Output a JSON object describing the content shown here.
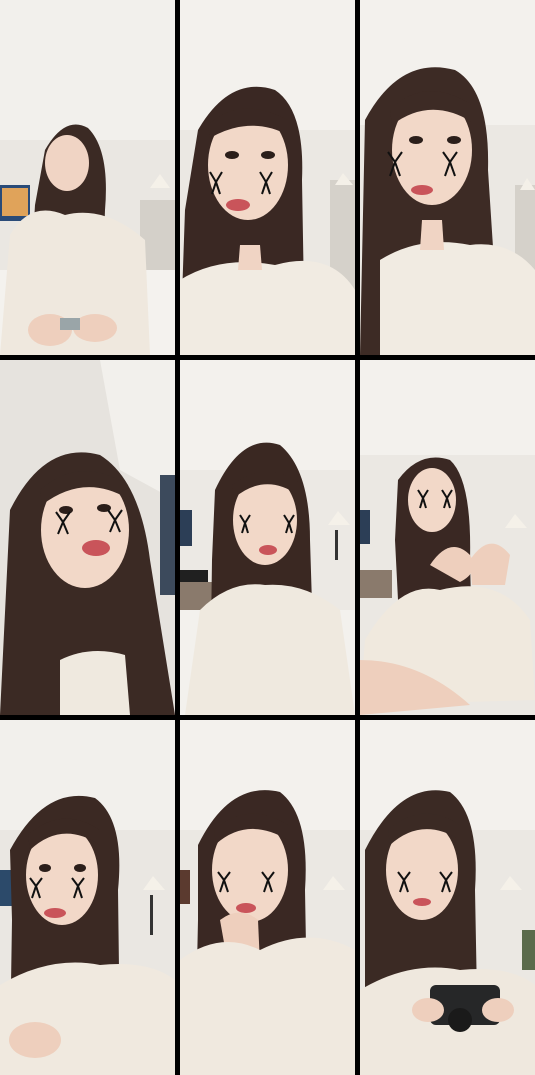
{
  "grid": {
    "rows": 3,
    "cols": 3,
    "background": "#000000",
    "tiles": [
      {
        "scene": "wide-seated-room",
        "wall": "#eae7e2",
        "sweater": "#efe8de",
        "hair": "#3b2a24"
      },
      {
        "scene": "closeup-left",
        "wall": "#ebe8e3",
        "sweater": "#f1ebe2",
        "hair": "#3a2823"
      },
      {
        "scene": "closeup-right",
        "wall": "#ebe8e3",
        "sweater": "#f1ebe2",
        "hair": "#3d2b25"
      },
      {
        "scene": "tilted-closeup",
        "wall": "#e6e3de",
        "sweater": "#efe9df",
        "hair": "#3b2a24"
      },
      {
        "scene": "medium-bed",
        "wall": "#ece9e4",
        "sweater": "#efe9df",
        "hair": "#3a2822"
      },
      {
        "scene": "heart-hands",
        "wall": "#ebe8e3",
        "sweater": "#f0e9de",
        "hair": "#3a2823"
      },
      {
        "scene": "talking-hand",
        "wall": "#eae7e2",
        "sweater": "#f0e9df",
        "hair": "#3b2923"
      },
      {
        "scene": "chin-on-hand",
        "wall": "#ebe8e3",
        "sweater": "#f0e9df",
        "hair": "#3a2823"
      },
      {
        "scene": "holding-camera",
        "wall": "#ebe8e3",
        "sweater": "#efe8de",
        "hair": "#3b2a24"
      }
    ]
  }
}
